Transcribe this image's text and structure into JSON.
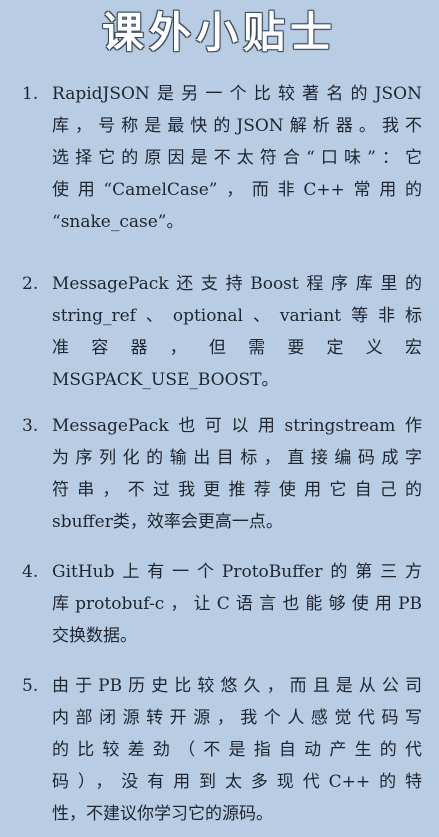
{
  "title": "课外小贴士",
  "tips": [
    {
      "number": "1.",
      "lines": [
        "RapidJSON是另一个比较著名的JSON",
        "库，号称是最快的JSON解析器。我不",
        "选择它的原因是不太符合“口味”：它",
        "使用“CamelCase”，而非C++常用的",
        "“snake_case”。"
      ]
    },
    {
      "number": "2.",
      "lines": [
        "MessagePack还支持Boost程序库里的",
        "string_ref、optional、variant等非标",
        "准 容 器 ， 但 需 要 定 义 宏",
        "MSGPACK_USE_BOOST。"
      ]
    },
    {
      "number": "3.",
      "lines": [
        "MessagePack也可以用stringstream作",
        "为序列化的输出目标，直接编码成字",
        "符串，不过我更推荐使用它自己的",
        "sbuffer类，效率会更高一点。"
      ]
    },
    {
      "number": "4.",
      "lines": [
        "GitHub上有一个ProtoBuffer的第三方",
        "库protobuf-c，让C语言也能够使用PB",
        "交换数据。"
      ]
    },
    {
      "number": "5.",
      "lines": [
        "由于PB历史比较悠久，而且是从公司",
        "内部闭源转开源，我个人感觉代码写",
        "的比较差劲（不是指自动产生的代",
        "码），没有用到太多现代C++的特",
        "性，不建议你学习它的源码。"
      ]
    }
  ]
}
